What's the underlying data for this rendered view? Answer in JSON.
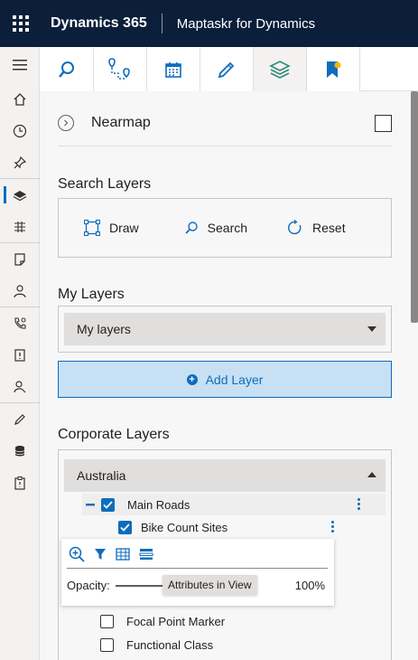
{
  "header": {
    "app_name": "Dynamics 365",
    "app_subtitle": "Maptaskr for Dynamics",
    "background": "#0b1f3a"
  },
  "left_nav": {
    "items": [
      {
        "icon": "hamburger-icon"
      },
      {
        "icon": "home-icon"
      },
      {
        "icon": "recent-clock-icon"
      },
      {
        "icon": "pin-icon"
      },
      {
        "icon": "layers-icon",
        "active": true
      },
      {
        "icon": "network-icon"
      },
      {
        "icon": "note-icon"
      },
      {
        "icon": "person-icon"
      },
      {
        "icon": "phone-settings-icon"
      },
      {
        "icon": "alert-document-icon"
      },
      {
        "icon": "person-search-icon"
      },
      {
        "icon": "pencil-icon"
      },
      {
        "icon": "database-icon"
      },
      {
        "icon": "clipboard-icon"
      }
    ]
  },
  "toolbar": {
    "tabs": [
      {
        "icon": "search-icon"
      },
      {
        "icon": "route-icon"
      },
      {
        "icon": "calendar-icon"
      },
      {
        "icon": "pencil-icon"
      },
      {
        "icon": "layers-icon",
        "active": true
      },
      {
        "icon": "bookmark-icon"
      }
    ],
    "accent": "#0f6cbd"
  },
  "panel": {
    "nearmap": {
      "label": "Nearmap",
      "checked": false
    },
    "search_layers": {
      "title": "Search Layers",
      "draw_label": "Draw",
      "search_label": "Search",
      "reset_label": "Reset"
    },
    "my_layers": {
      "title": "My Layers",
      "selected": "My layers"
    },
    "add_layer_label": "Add Layer",
    "corporate_layers": {
      "title": "Corporate Layers",
      "group": "Australia",
      "parent_layer": {
        "label": "Main Roads",
        "checked": true
      },
      "layers": [
        {
          "label": "Bike Count Sites",
          "checked": true
        },
        {
          "label": "Focal Point Marker",
          "checked": false
        },
        {
          "label": "Functional Class",
          "checked": false
        }
      ]
    },
    "layer_popover": {
      "opacity_label": "Opacity:",
      "opacity_value": "100%",
      "opacity_fraction": 1.0,
      "tooltip": "Attributes in View",
      "icons": [
        "zoom-to-layer-icon",
        "filter-icon",
        "table-icon",
        "legend-icon"
      ]
    }
  }
}
